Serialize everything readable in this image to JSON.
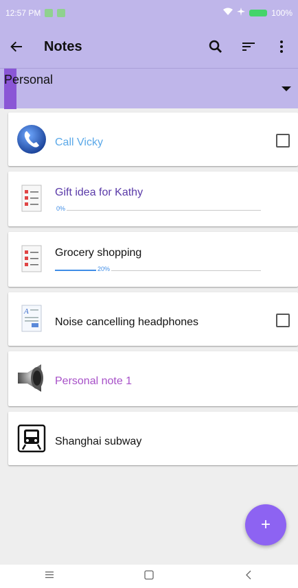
{
  "status": {
    "time": "12:57 PM",
    "battery": "100%"
  },
  "toolbar": {
    "title": "Notes",
    "icons": [
      "back-arrow-icon",
      "search-icon",
      "sort-icon",
      "more-vert-icon"
    ]
  },
  "category": {
    "label": "Personal",
    "marker_color": "#8a56d6"
  },
  "notes": [
    {
      "title": "Call Vicky",
      "title_color": "#5aa8e8",
      "icon": "phone-icon",
      "checkbox": true
    },
    {
      "title": "Gift idea for Kathy",
      "title_color": "#5a3aa8",
      "icon": "checklist-icon",
      "progress": {
        "value": 0,
        "label": "0%"
      }
    },
    {
      "title": "Grocery shopping",
      "title_color": "#111111",
      "icon": "checklist-icon",
      "progress": {
        "value": 20,
        "label": "20%"
      }
    },
    {
      "title": "Noise cancelling headphones",
      "title_color": "#111111",
      "icon": "document-icon",
      "checkbox": true
    },
    {
      "title": "Personal note 1",
      "title_color": "#a750c8",
      "icon": "speaker-icon"
    },
    {
      "title": "Shanghai subway",
      "title_color": "#111111",
      "icon": "train-icon"
    }
  ],
  "fab": {
    "label": "+"
  },
  "navbar": {
    "icons": [
      "menu-icon",
      "home-icon",
      "back-icon"
    ]
  }
}
